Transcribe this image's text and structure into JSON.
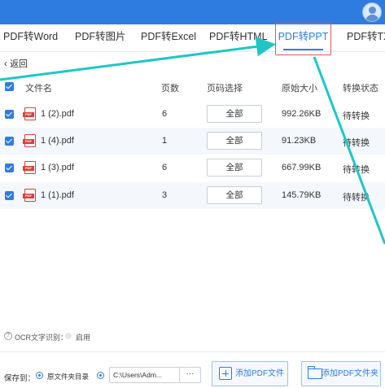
{
  "tabs": [
    {
      "label": "PDF转Word"
    },
    {
      "label": "PDF转图片"
    },
    {
      "label": "PDF转Excel"
    },
    {
      "label": "PDF转HTML"
    },
    {
      "label": "PDF转PPT",
      "active": true
    },
    {
      "label": "PDF转TXT"
    }
  ],
  "nav": {
    "back_label": "返回",
    "back_icon": "chevron-left-icon"
  },
  "table": {
    "headers": [
      "文件名",
      "页数",
      "页码选择",
      "原始大小",
      "转换状态"
    ],
    "rows": [
      {
        "name": "1 (2).pdf",
        "pages": "6",
        "page_select": "全部",
        "size": "992.26KB",
        "status": "待转换"
      },
      {
        "name": "1 (4).pdf",
        "pages": "1",
        "page_select": "全部",
        "size": "91.23KB",
        "status": "待转换"
      },
      {
        "name": "1 (3).pdf",
        "pages": "6",
        "page_select": "全部",
        "size": "667.99KB",
        "status": "待转换"
      },
      {
        "name": "1 (1).pdf",
        "pages": "3",
        "page_select": "全部",
        "size": "145.79KB",
        "status": "待转换"
      }
    ]
  },
  "ocr": {
    "label": "OCR文字识别：",
    "toggle_label": "启用",
    "help_icon": "question-icon"
  },
  "footer": {
    "save_to_label": "保存到：",
    "option_source": "原文件夹目录",
    "path_value": "C:\\Users\\Adm...",
    "path_browse": "···",
    "add_file_button": "添加PDF文件",
    "add_folder_button": "添加PDF文件夹"
  },
  "colors": {
    "accent": "#2f7ce0",
    "highlight": "#e2555d",
    "annotation_arrow": "#1fc6c6",
    "pdf_red": "#d9403a"
  }
}
